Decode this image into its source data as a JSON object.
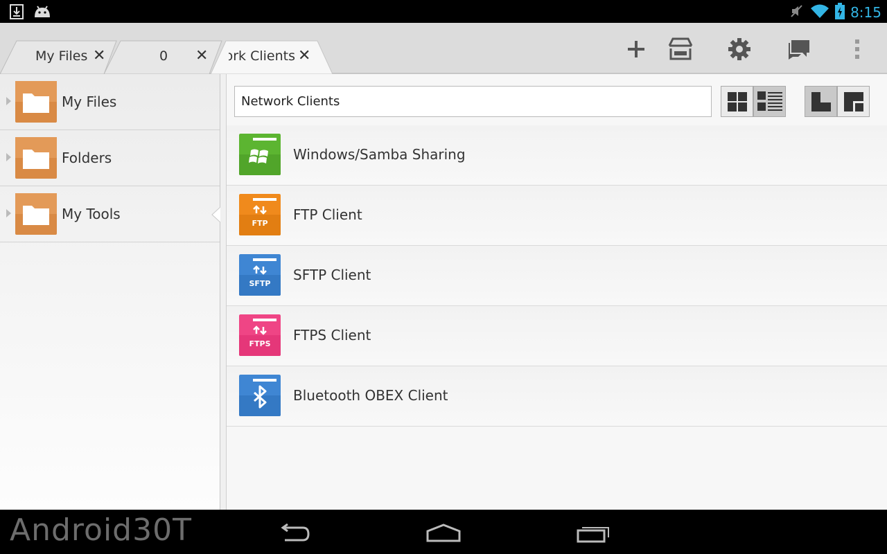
{
  "status_bar": {
    "time": "8:15",
    "icons": [
      "download-notification-icon",
      "android-debug-icon",
      "muted-icon",
      "wifi-icon",
      "battery-charging-icon"
    ]
  },
  "tabs": [
    {
      "label": "My Files",
      "active": false
    },
    {
      "label": "0",
      "active": false
    },
    {
      "label": "ork Clients",
      "active": true
    }
  ],
  "tab_close_glyph": "✕",
  "toolbar_actions": [
    "add-icon",
    "store-icon",
    "settings-icon",
    "chat-icon",
    "overflow-menu-icon"
  ],
  "sidebar": {
    "items": [
      {
        "label": "My Files"
      },
      {
        "label": "Folders"
      },
      {
        "label": "My Tools"
      }
    ]
  },
  "path_bar": {
    "value": "Network Clients"
  },
  "view_modes": [
    "grid-view-icon",
    "list-view-icon",
    "single-pane-icon",
    "dual-pane-icon"
  ],
  "network_clients": [
    {
      "label": "Windows/Samba Sharing",
      "icon": "windows-samba-icon",
      "color": "#5cb531",
      "badge": ""
    },
    {
      "label": "FTP Client",
      "icon": "ftp-icon",
      "color": "#f08a1c",
      "badge": "FTP"
    },
    {
      "label": "SFTP Client",
      "icon": "sftp-icon",
      "color": "#3f86d3",
      "badge": "SFTP"
    },
    {
      "label": "FTPS Client",
      "icon": "ftps-icon",
      "color": "#ef4585",
      "badge": "FTPS"
    },
    {
      "label": "Bluetooth OBEX Client",
      "icon": "bluetooth-icon",
      "color": "#3f86d3",
      "badge": ""
    }
  ],
  "nav_bar": {
    "watermark": "Android30T",
    "buttons": [
      "back-icon",
      "home-icon",
      "recent-apps-icon"
    ]
  },
  "colors": {
    "accent": "#33b5e5",
    "folder": "#d98a45"
  }
}
